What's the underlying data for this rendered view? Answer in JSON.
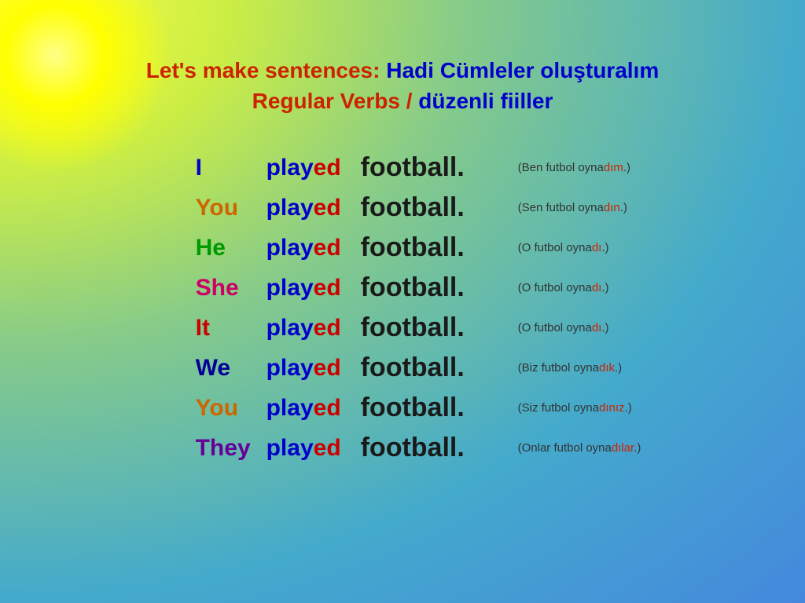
{
  "title": {
    "line1_red": "Let's make sentences: ",
    "line1_blue": "Hadi Cümleler oluşturalım",
    "line2": "Regular Verbs / ",
    "line2_blue": "düzenli fiiller"
  },
  "rows": [
    {
      "subject": "I",
      "subject_class": "subj-I",
      "translation_prefix": "(Ben futbol oyna",
      "translation_suffix": "dım",
      "translation_end": ".)"
    },
    {
      "subject": "You",
      "subject_class": "subj-You",
      "translation_prefix": "(Sen futbol oyna",
      "translation_suffix": "dın",
      "translation_end": ".)"
    },
    {
      "subject": "He",
      "subject_class": "subj-He",
      "translation_prefix": "(O futbol oyna",
      "translation_suffix": "dı",
      "translation_end": ".)"
    },
    {
      "subject": "She",
      "subject_class": "subj-She",
      "translation_prefix": "(O futbol oyna",
      "translation_suffix": "dı",
      "translation_end": ".)"
    },
    {
      "subject": "It",
      "subject_class": "subj-It",
      "translation_prefix": "(O futbol oyna",
      "translation_suffix": "dı",
      "translation_end": ".)"
    },
    {
      "subject": "We",
      "subject_class": "subj-We",
      "translation_prefix": "(Biz futbol oyna",
      "translation_suffix": "dık",
      "translation_end": ".)"
    },
    {
      "subject": "You",
      "subject_class": "subj-You2",
      "translation_prefix": "(Siz futbol oyna",
      "translation_suffix": "dınız",
      "translation_end": ".)"
    },
    {
      "subject": "They",
      "subject_class": "subj-They",
      "translation_prefix": "(Onlar futbol oyna",
      "translation_suffix": "dılar",
      "translation_end": ".)"
    }
  ]
}
